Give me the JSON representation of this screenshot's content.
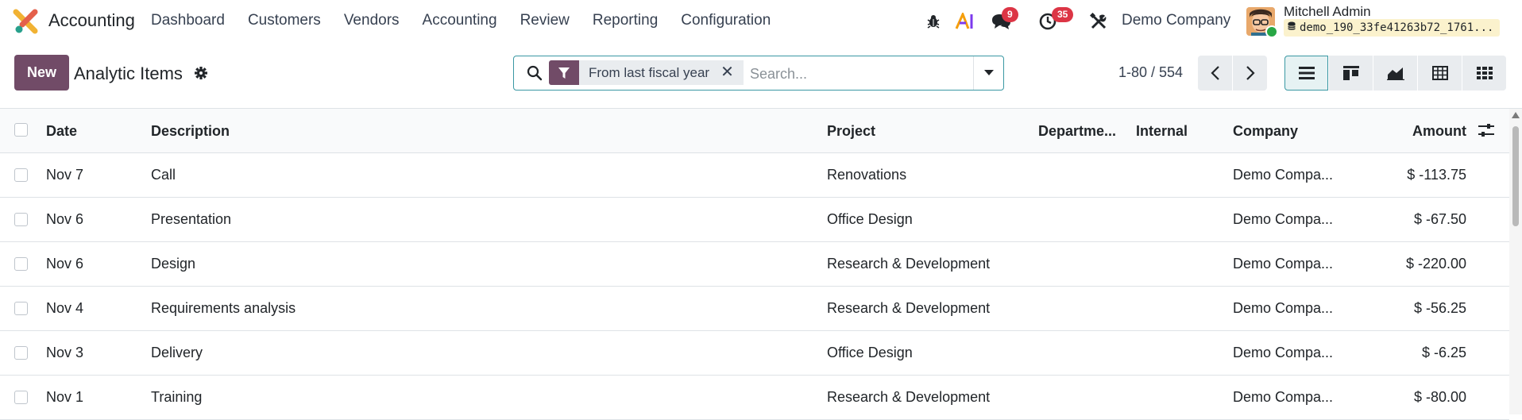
{
  "navbar": {
    "app_name": "Accounting",
    "menu": [
      "Dashboard",
      "Customers",
      "Vendors",
      "Accounting",
      "Review",
      "Reporting",
      "Configuration"
    ],
    "icons": [
      "bug-icon",
      "ai-icon",
      "chat-icon",
      "activity-clock-icon",
      "tools-icon"
    ],
    "messages_count": "9",
    "activities_count": "35",
    "company": "Demo Company",
    "user_name": "Mitchell Admin",
    "database": "demo_190_33fe41263b72_1761..."
  },
  "control_panel": {
    "new_label": "New",
    "title": "Analytic Items",
    "facet_label": "From last fiscal year",
    "search_placeholder": "Search...",
    "pager": "1-80 / 554",
    "views": [
      "list-view-icon",
      "kanban-view-icon",
      "graph-view-icon",
      "pivot-view-icon",
      "grid-view-icon"
    ],
    "active_view": "list"
  },
  "table": {
    "columns": [
      "Date",
      "Description",
      "Project",
      "Departme...",
      "Internal",
      "Company",
      "Amount"
    ],
    "rows": [
      {
        "date": "Nov 7",
        "description": "Call",
        "project": "Renovations",
        "department": "",
        "internal": "",
        "company": "Demo Compa...",
        "amount": "$ -113.75"
      },
      {
        "date": "Nov 6",
        "description": "Presentation",
        "project": "Office Design",
        "department": "",
        "internal": "",
        "company": "Demo Compa...",
        "amount": "$ -67.50"
      },
      {
        "date": "Nov 6",
        "description": "Design",
        "project": "Research & Development",
        "department": "",
        "internal": "",
        "company": "Demo Compa...",
        "amount": "$ -220.00"
      },
      {
        "date": "Nov 4",
        "description": "Requirements analysis",
        "project": "Research & Development",
        "department": "",
        "internal": "",
        "company": "Demo Compa...",
        "amount": "$ -56.25"
      },
      {
        "date": "Nov 3",
        "description": "Delivery",
        "project": "Office Design",
        "department": "",
        "internal": "",
        "company": "Demo Compa...",
        "amount": "$ -6.25"
      },
      {
        "date": "Nov 1",
        "description": "Training",
        "project": "Research & Development",
        "department": "",
        "internal": "",
        "company": "Demo Compa...",
        "amount": "$ -80.00"
      }
    ]
  },
  "colors": {
    "brand": "#714b67",
    "accent": "#3a98a3",
    "badge": "#dc3545"
  }
}
